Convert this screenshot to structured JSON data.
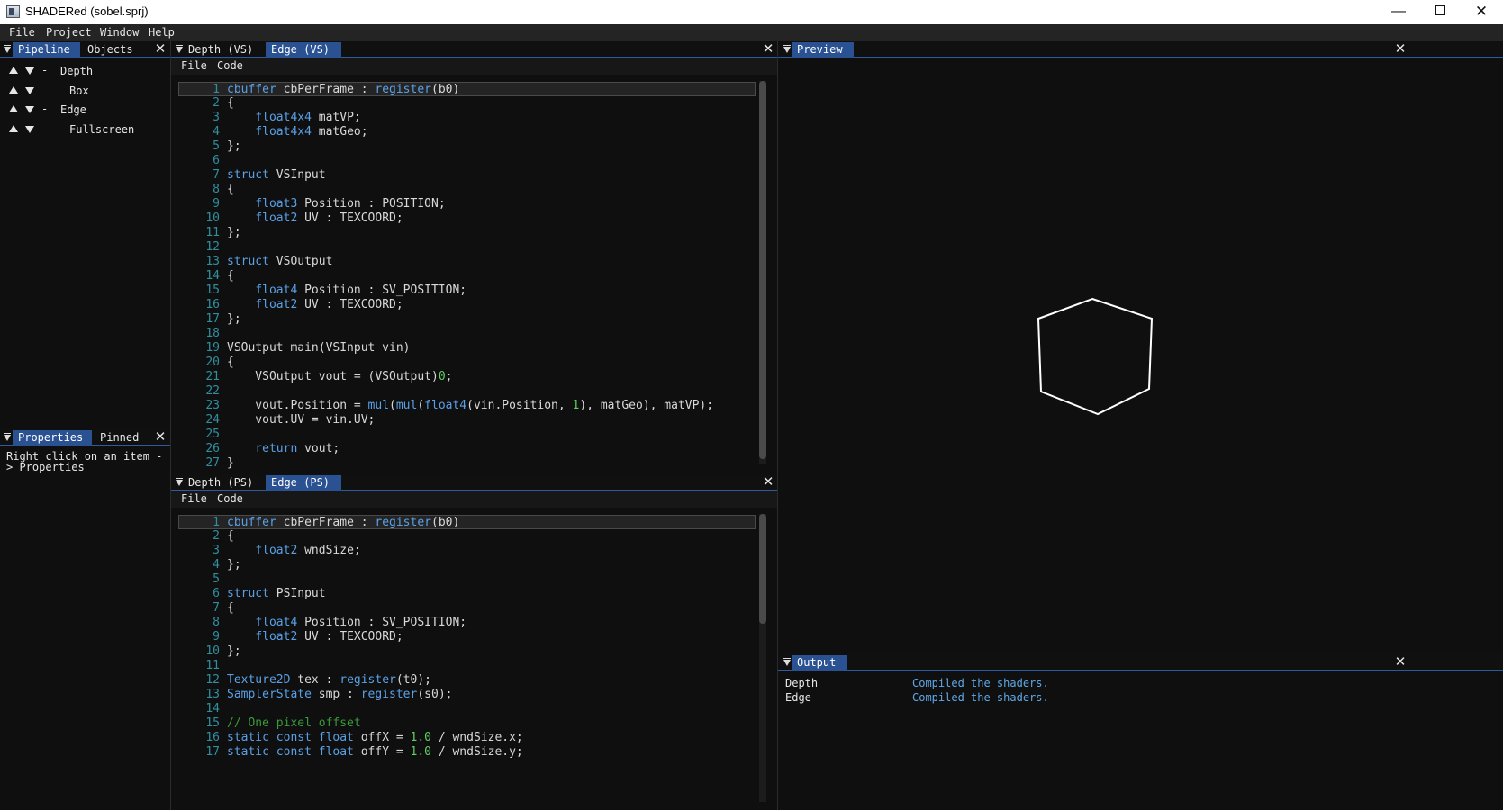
{
  "window": {
    "title": "SHADERed (sobel.sprj)",
    "controls": {
      "minimize": "—",
      "close": "✕"
    }
  },
  "menubar": {
    "items": [
      "File",
      "Project",
      "Window",
      "Help"
    ]
  },
  "pipeline_panel": {
    "tabs": [
      "Pipeline",
      "Objects"
    ],
    "active_tab": "Pipeline",
    "items": [
      {
        "label": "Depth",
        "kind": "pass",
        "collapse": "-"
      },
      {
        "label": "Box",
        "kind": "item"
      },
      {
        "label": "Edge",
        "kind": "pass",
        "collapse": "-"
      },
      {
        "label": "Fullscreen",
        "kind": "item"
      }
    ]
  },
  "properties_panel": {
    "tabs": [
      "Properties",
      "Pinned"
    ],
    "active_tab": "Properties",
    "hint": "Right click on an item -> Properties"
  },
  "vs_editor": {
    "tabs": [
      "Depth (VS)",
      "Edge (VS)"
    ],
    "active_tab": "Edge (VS)",
    "menu": [
      "File",
      "Code"
    ],
    "lines": [
      "[kw]cbuffer[/kw] cbPerFrame : [kw]register[/kw](b0)",
      "{",
      "    [kw]float4x4[/kw] matVP;",
      "    [kw]float4x4[/kw] matGeo;",
      "};",
      "",
      "[kw]struct[/kw] VSInput",
      "{",
      "    [kw]float3[/kw] Position : POSITION;",
      "    [kw]float2[/kw] UV : TEXCOORD;",
      "};",
      "",
      "[kw]struct[/kw] VSOutput",
      "{",
      "    [kw]float4[/kw] Position : SV_POSITION;",
      "    [kw]float2[/kw] UV : TEXCOORD;",
      "};",
      "",
      "VSOutput main(VSInput vin)",
      "{",
      "    VSOutput vout = (VSOutput)[num]0[/num];",
      "",
      "    vout.Position = [kw]mul[/kw]([kw]mul[/kw]([kw]float4[/kw](vin.Position, [num]1[/num]), matGeo), matVP);",
      "    vout.UV = vin.UV;",
      "",
      "    [kw]return[/kw] vout;",
      "}"
    ]
  },
  "ps_editor": {
    "tabs": [
      "Depth (PS)",
      "Edge (PS)"
    ],
    "active_tab": "Edge (PS)",
    "menu": [
      "File",
      "Code"
    ],
    "lines": [
      "[kw]cbuffer[/kw] cbPerFrame : [kw]register[/kw](b0)",
      "{",
      "    [kw]float2[/kw] wndSize;",
      "};",
      "",
      "[kw]struct[/kw] PSInput",
      "{",
      "    [kw]float4[/kw] Position : SV_POSITION;",
      "    [kw]float2[/kw] UV : TEXCOORD;",
      "};",
      "",
      "[kw]Texture2D[/kw] tex : [kw]register[/kw](t0);",
      "[kw]SamplerState[/kw] smp : [kw]register[/kw](s0);",
      "",
      "[cm]// One pixel offset[/cm]",
      "[kw]static const float[/kw] offX = [num]1.0[/num] / wndSize.x;",
      "[kw]static const float[/kw] offY = [num]1.0[/num] / wndSize.y;"
    ]
  },
  "preview_panel": {
    "tabs": [
      "Preview"
    ],
    "active_tab": "Preview"
  },
  "output_panel": {
    "tabs": [
      "Output"
    ],
    "active_tab": "Output",
    "messages": [
      {
        "source": "Depth",
        "text": "Compiled the shaders."
      },
      {
        "source": "Edge",
        "text": "Compiled the shaders."
      }
    ]
  },
  "colors": {
    "accent_tab": "#2a5191",
    "keyword": "#5aa0e6",
    "number": "#60d060",
    "comment": "#3a9a3a",
    "line_number": "#2f8f9f",
    "output_message": "#5fa8e8"
  }
}
